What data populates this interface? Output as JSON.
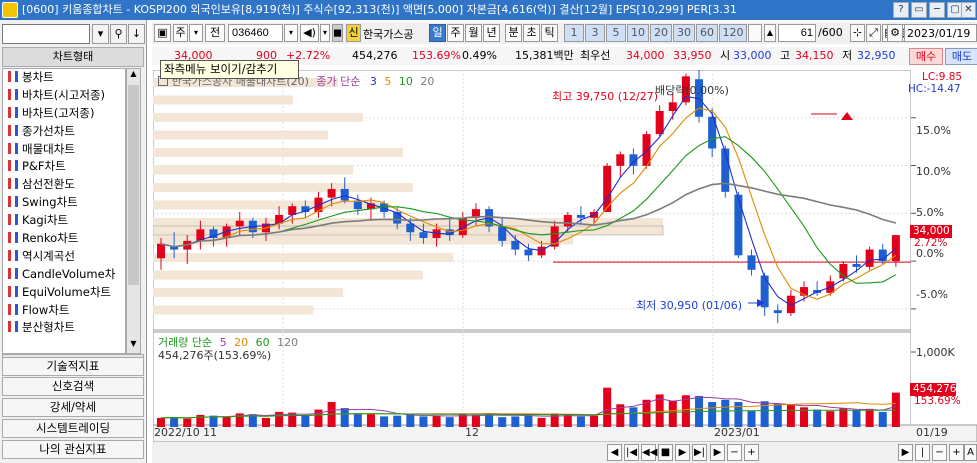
{
  "titlebar": {
    "text": "[0600] 키움종합차트 - KOSPI200 외국인보유[8,919(천)] 주식수[92,313(천)] 액면[5,000] 자본금[4,616(억)] 결산[12월] EPS[10,299] PER[3.31",
    "buttons": [
      "?",
      "▭",
      "─",
      "▢",
      "✕"
    ]
  },
  "sidebar": {
    "search_value": "",
    "category_label": "차트형태",
    "items": [
      "봉차트",
      "바차트(시고저종)",
      "바차트(고저종)",
      "종가선차트",
      "매물대차트",
      "P&F차트",
      "삼선전환도",
      "Swing차트",
      "Kagi차트",
      "Renko차트",
      "역시계곡선",
      "CandleVolume차",
      "EquiVolume차트",
      "Flow차트",
      "분산형차트"
    ],
    "menu": [
      "기술적지표",
      "신호검색",
      "강세/약세",
      "시스템트레이딩",
      "나의 관심지표"
    ]
  },
  "toolbar": {
    "mode": "주",
    "prev": "전",
    "code": "036460",
    "badge": "신",
    "name": "한국가스공",
    "periods": [
      "일",
      "주",
      "월",
      "년",
      "분",
      "초",
      "틱"
    ],
    "numbers": [
      "1",
      "3",
      "5",
      "10",
      "20",
      "30",
      "60",
      "120"
    ],
    "count": "61",
    "total": "/600",
    "date": "2023/01/19",
    "sell": "매수",
    "buy": "매도"
  },
  "info": {
    "price": "34,000",
    "change": "900",
    "change_pct": "+2.72%",
    "volume": "454,276",
    "vol_pct": "153.69%",
    "turnover": "0.49%",
    "amount": "15,381백만",
    "ask_label": "최우선",
    "ask": "34,000",
    "bid": "33,950",
    "open_label": "시",
    "open": "33,000",
    "high_label": "고",
    "high": "34,150",
    "low_label": "저",
    "low": "32,950"
  },
  "tooltip": "좌측메뉴 보이기/감추기",
  "chart": {
    "legend_text": "한국가스공사 매물대차트(20)",
    "legend_series": "종가 단순",
    "ma_periods": [
      "3",
      "5",
      "10",
      "20"
    ],
    "lc": "LC:9.85",
    "hc": "HC:-14.47",
    "high_label": "최고 39,750 (12/27)",
    "dividend_label": "배당락(0.00%)",
    "low_label": "최저 30,950 (01/06)",
    "price_tag": "34,000",
    "pct_tag": "2.72%",
    "yticks": [
      "15.0%",
      "10.0%",
      "5.0%",
      "0.0%",
      "-5.0%"
    ],
    "vol_legend": "거래량 단순",
    "vol_ma": [
      "5",
      "20",
      "60",
      "120"
    ],
    "vol_value": "454,276주(153.69%)",
    "vol_tick": "1,000K",
    "vol_tag": "454,276",
    "vol_pct_tag": "153.69%",
    "xticks": [
      "2022/10",
      "11",
      "12",
      "2023/01"
    ],
    "last_date": "01/19",
    "colors": {
      "up": "#e3001b",
      "down": "#1e5fd1"
    }
  },
  "chart_data": {
    "type": "candlestick",
    "candles": [
      [
        33.2,
        33.9,
        32.8,
        33.7
      ],
      [
        33.6,
        34.1,
        33.2,
        33.5
      ],
      [
        33.5,
        34.0,
        33.0,
        33.8
      ],
      [
        33.8,
        34.5,
        33.5,
        34.2
      ],
      [
        34.2,
        34.3,
        33.6,
        33.9
      ],
      [
        33.9,
        34.4,
        33.6,
        34.3
      ],
      [
        34.3,
        34.8,
        34.0,
        34.5
      ],
      [
        34.5,
        34.6,
        33.9,
        34.1
      ],
      [
        34.1,
        34.6,
        33.8,
        34.4
      ],
      [
        34.4,
        35.0,
        34.2,
        34.7
      ],
      [
        34.7,
        35.1,
        34.4,
        35.0
      ],
      [
        35.0,
        35.2,
        34.6,
        34.8
      ],
      [
        34.8,
        35.5,
        34.6,
        35.3
      ],
      [
        35.3,
        35.8,
        35.0,
        35.6
      ],
      [
        35.6,
        36.0,
        35.1,
        35.2
      ],
      [
        35.2,
        35.4,
        34.7,
        34.9
      ],
      [
        34.9,
        35.3,
        34.5,
        35.1
      ],
      [
        35.1,
        35.2,
        34.6,
        34.8
      ],
      [
        34.8,
        35.0,
        34.2,
        34.4
      ],
      [
        34.4,
        34.6,
        33.8,
        34.1
      ],
      [
        34.1,
        34.4,
        33.7,
        33.9
      ],
      [
        33.9,
        34.4,
        33.6,
        34.2
      ],
      [
        34.2,
        34.6,
        33.8,
        34.0
      ],
      [
        34.0,
        34.8,
        33.9,
        34.6
      ],
      [
        34.6,
        35.1,
        34.3,
        34.9
      ],
      [
        34.9,
        35.0,
        34.1,
        34.3
      ],
      [
        34.3,
        34.6,
        33.6,
        33.8
      ],
      [
        33.8,
        34.0,
        33.3,
        33.5
      ],
      [
        33.5,
        33.7,
        33.1,
        33.3
      ],
      [
        33.3,
        33.8,
        33.2,
        33.6
      ],
      [
        33.6,
        34.5,
        33.5,
        34.3
      ],
      [
        34.3,
        34.8,
        34.1,
        34.7
      ],
      [
        34.7,
        35.0,
        34.4,
        34.6
      ],
      [
        34.6,
        34.9,
        34.4,
        34.8
      ],
      [
        34.8,
        36.5,
        34.8,
        36.4
      ],
      [
        36.4,
        36.9,
        36.0,
        36.8
      ],
      [
        36.8,
        37.0,
        36.1,
        36.4
      ],
      [
        36.4,
        37.6,
        36.3,
        37.5
      ],
      [
        37.5,
        38.5,
        37.4,
        38.3
      ],
      [
        38.3,
        38.9,
        38.0,
        38.6
      ],
      [
        38.6,
        39.6,
        38.5,
        39.5
      ],
      [
        39.4,
        39.75,
        37.9,
        38.1
      ],
      [
        38.1,
        38.4,
        36.7,
        37.0
      ],
      [
        37.0,
        37.1,
        35.3,
        35.5
      ],
      [
        35.4,
        35.5,
        33.2,
        33.3
      ],
      [
        33.3,
        33.5,
        32.6,
        32.8
      ],
      [
        32.6,
        32.7,
        31.2,
        31.5
      ],
      [
        31.4,
        31.6,
        30.95,
        31.3
      ],
      [
        31.3,
        32.1,
        31.2,
        31.9
      ],
      [
        31.9,
        32.4,
        31.7,
        32.2
      ],
      [
        32.1,
        32.4,
        31.9,
        32.0
      ],
      [
        32.0,
        32.6,
        31.9,
        32.4
      ],
      [
        32.5,
        33.1,
        32.4,
        33.0
      ],
      [
        33.0,
        33.3,
        32.7,
        32.9
      ],
      [
        32.9,
        33.6,
        32.8,
        33.5
      ],
      [
        33.5,
        33.7,
        33.0,
        33.1
      ],
      [
        33.1,
        34.0,
        32.9,
        34.0
      ]
    ],
    "ylim_pct": [
      -7.0,
      20.0
    ],
    "base_close": 33100,
    "volume": [
      120,
      130,
      110,
      160,
      150,
      140,
      180,
      170,
      120,
      200,
      190,
      160,
      230,
      330,
      250,
      180,
      170,
      140,
      150,
      160,
      140,
      150,
      130,
      170,
      160,
      180,
      130,
      140,
      150,
      120,
      180,
      160,
      140,
      150,
      520,
      300,
      260,
      360,
      430,
      350,
      420,
      410,
      330,
      360,
      330,
      210,
      340,
      310,
      290,
      260,
      230,
      210,
      250,
      220,
      240,
      200,
      454
    ],
    "volume_unit": "K",
    "ma_colors": {
      "3": "#1f2fd0",
      "5": "#e08a00",
      "10": "#1a9a1a",
      "20": "#7c7c7c"
    }
  }
}
